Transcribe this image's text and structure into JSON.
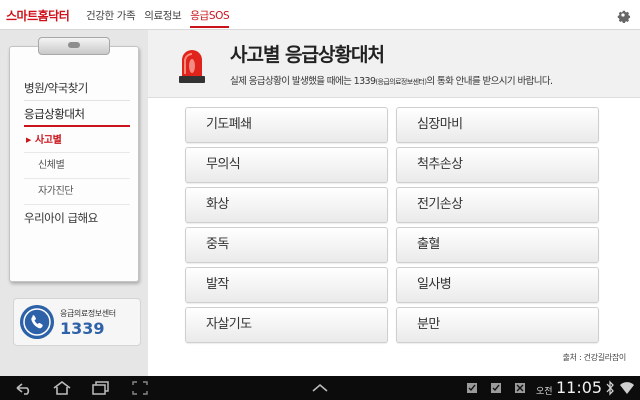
{
  "app": {
    "brand": "스마트홈닥터"
  },
  "nav": [
    {
      "label": "건강한 가족",
      "active": false
    },
    {
      "label": "의료정보",
      "active": false
    },
    {
      "label": "응급SOS",
      "active": true
    }
  ],
  "sidebar": {
    "items": [
      {
        "label": "병원/약국찾기"
      },
      {
        "label": "응급상황대처"
      },
      {
        "label": "사고별"
      },
      {
        "label": "신체별"
      },
      {
        "label": "자가진단"
      },
      {
        "label": "우리아이 급해요"
      }
    ],
    "hotline_label": "응급의료정보센터",
    "hotline_number": "1339"
  },
  "page": {
    "title": "사고별 응급상황대처",
    "subtitle_pre": "실제 응급상황이 발생했을 때에는 1339",
    "subtitle_small": "(응급의료정보센터)",
    "subtitle_post": "의 통화 안내를 받으시기 바랍니다.",
    "source": "출처 : 건강길라잡이"
  },
  "buttons": [
    "기도폐쇄",
    "심장마비",
    "무의식",
    "척추손상",
    "화상",
    "전기손상",
    "중독",
    "출혈",
    "발작",
    "일사병",
    "자살기도",
    "분만"
  ],
  "status": {
    "ampm": "오전",
    "time": "11:05"
  },
  "colors": {
    "brand": "#d0111b",
    "accent": "#2e62a8"
  },
  "icons": [
    "settings-gear-icon",
    "siren-icon",
    "phone-icon",
    "back-icon",
    "home-icon",
    "recent-apps-icon",
    "screenshot-icon",
    "up-chevron-icon",
    "notification-icon",
    "wifi-icon",
    "bluetooth-icon"
  ]
}
